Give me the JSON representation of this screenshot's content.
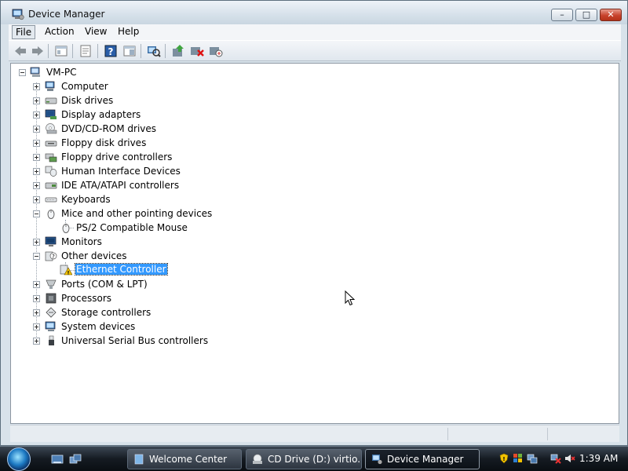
{
  "window": {
    "title": "Device Manager",
    "controls": {
      "minimize": "–",
      "maximize": "□",
      "close": "✕"
    }
  },
  "menu": {
    "items": [
      "File",
      "Action",
      "View",
      "Help"
    ],
    "active": "File"
  },
  "toolbar": {
    "buttons": [
      "back-icon",
      "forward-icon",
      "up-icon",
      "properties-icon",
      "help-icon",
      "show-hide-icon",
      "scan-icon",
      "update-driver-icon",
      "uninstall-icon",
      "disable-icon"
    ]
  },
  "tree": {
    "root": "VM-PC",
    "items": [
      {
        "label": "Computer",
        "icon": "computer-icon"
      },
      {
        "label": "Disk drives",
        "icon": "disk-icon"
      },
      {
        "label": "Display adapters",
        "icon": "display-icon"
      },
      {
        "label": "DVD/CD-ROM drives",
        "icon": "dvd-icon"
      },
      {
        "label": "Floppy disk drives",
        "icon": "floppy-icon"
      },
      {
        "label": "Floppy drive controllers",
        "icon": "controller-icon"
      },
      {
        "label": "Human Interface Devices",
        "icon": "hid-icon"
      },
      {
        "label": "IDE ATA/ATAPI controllers",
        "icon": "ide-icon"
      },
      {
        "label": "Keyboards",
        "icon": "keyboard-icon"
      },
      {
        "label": "Mice and other pointing devices",
        "icon": "mouse-icon",
        "expanded": true,
        "children": [
          {
            "label": "PS/2 Compatible Mouse",
            "icon": "mouse-icon"
          }
        ]
      },
      {
        "label": "Monitors",
        "icon": "monitor-icon"
      },
      {
        "label": "Other devices",
        "icon": "unknown-device-icon",
        "expanded": true,
        "children": [
          {
            "label": "Ethernet Controller",
            "icon": "warning-device-icon",
            "selected": true
          }
        ]
      },
      {
        "label": "Ports (COM & LPT)",
        "icon": "port-icon"
      },
      {
        "label": "Processors",
        "icon": "processor-icon"
      },
      {
        "label": "Storage controllers",
        "icon": "storage-icon"
      },
      {
        "label": "System devices",
        "icon": "system-icon"
      },
      {
        "label": "Universal Serial Bus controllers",
        "icon": "usb-icon"
      }
    ]
  },
  "taskbar": {
    "buttons": [
      {
        "label": "Welcome Center",
        "icon": "welcome-icon",
        "active": false
      },
      {
        "label": "CD Drive (D:) virtio...",
        "icon": "cd-drive-icon",
        "active": false
      },
      {
        "label": "Device Manager",
        "icon": "device-manager-icon",
        "active": true
      }
    ],
    "clock": "1:39 AM",
    "tray_icons": [
      "security-shield-icon",
      "volume-network-icon",
      "volume-icon"
    ]
  }
}
